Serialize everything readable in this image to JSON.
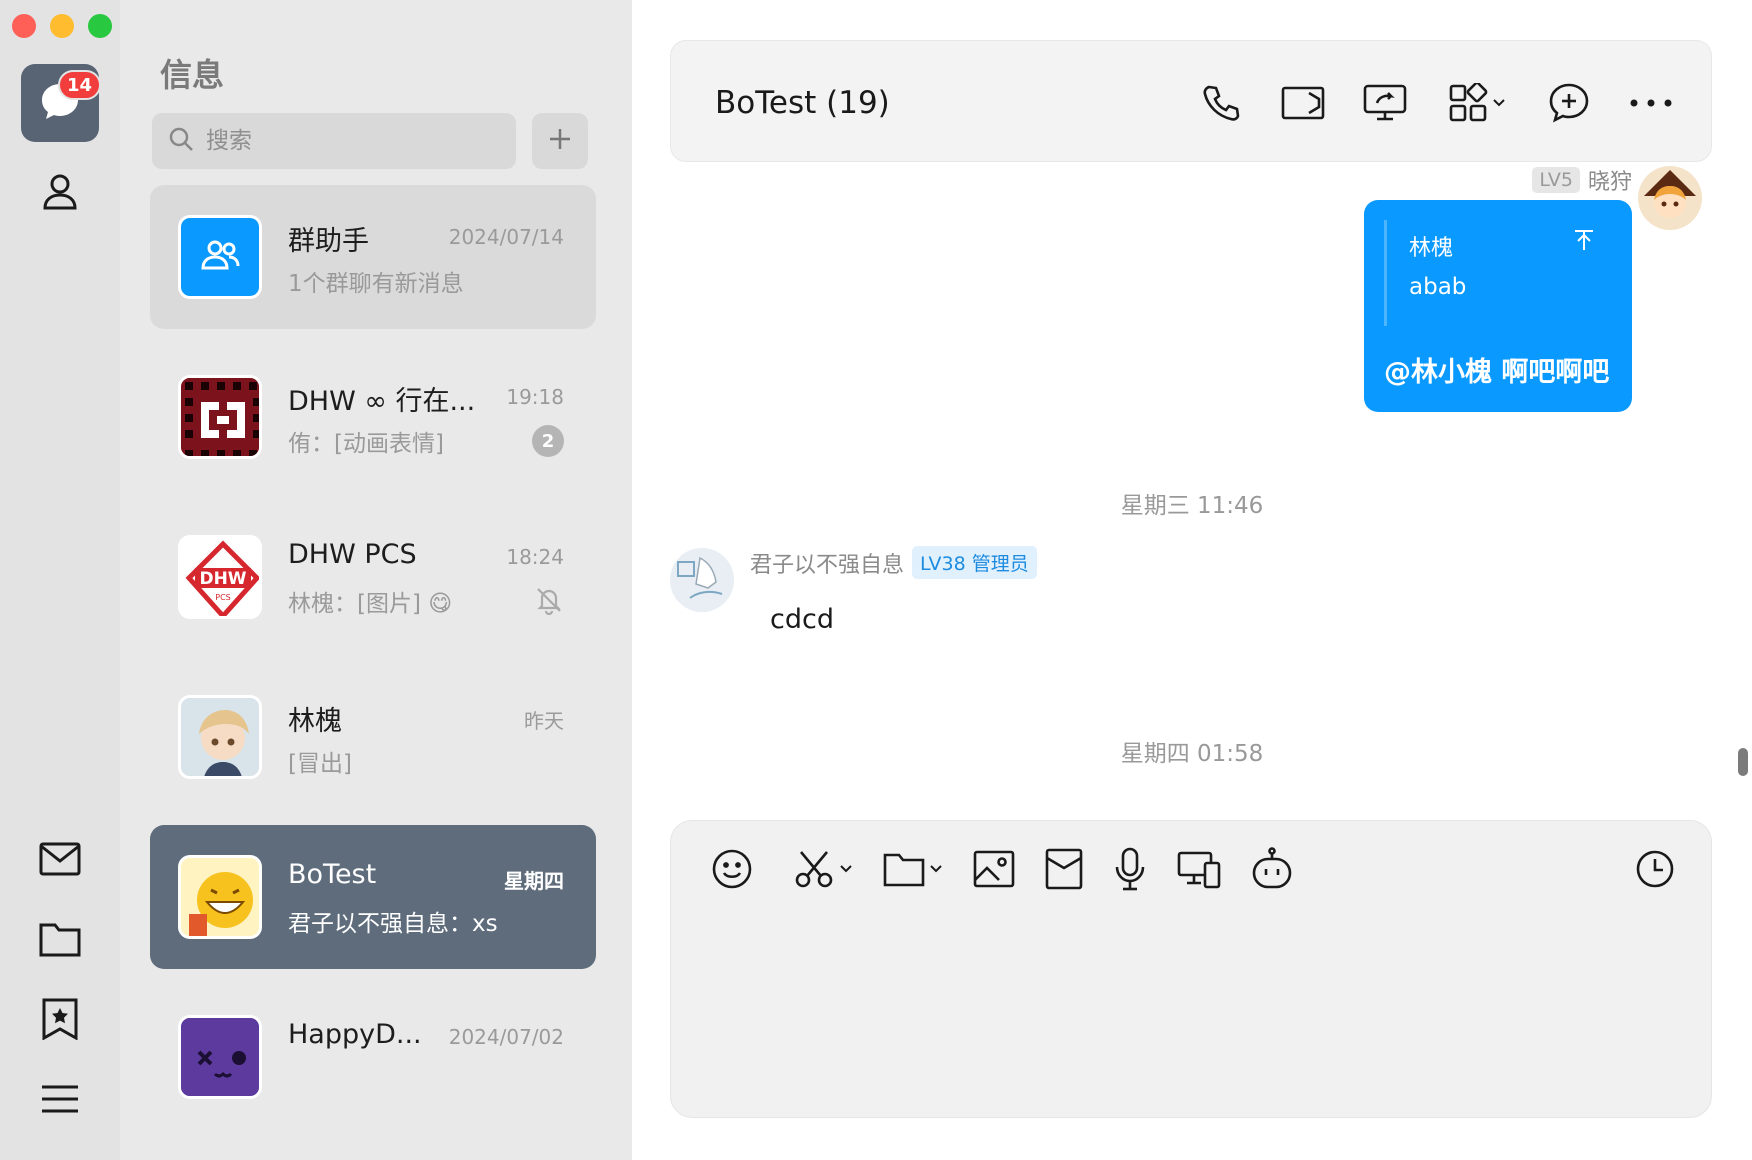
{
  "sidebar": {
    "messages_badge": "14"
  },
  "list": {
    "title": "信息",
    "search_placeholder": "搜索",
    "conversations": [
      {
        "name": "群助手",
        "time": "2024/07/14",
        "preview": "1个群聊有新消息"
      },
      {
        "name": "DHW ∞ 行在...",
        "time": "19:18",
        "preview": "侑：[动画表情]",
        "unread": "2"
      },
      {
        "name": "DHW PCS",
        "time": "18:24",
        "preview": "林槐：[图片] 😋",
        "muted": true
      },
      {
        "name": "林槐",
        "time": "昨天",
        "preview": "[冒出]"
      },
      {
        "name": "BoTest",
        "time": "星期四",
        "preview": "君子以不强自息：xs",
        "selected": true
      },
      {
        "name": "HappyD...",
        "time": "2024/07/02",
        "preview": ""
      }
    ]
  },
  "chat": {
    "title": "BoTest (19)",
    "messages": [
      {
        "direction": "out",
        "sender_level": "LV5",
        "sender_name": "晓狩",
        "quote_name": "林槐",
        "quote_text": "abab",
        "text": "@林小槐 啊吧啊吧"
      },
      {
        "type": "timestamp",
        "text": "星期三 11:46"
      },
      {
        "direction": "in",
        "sender_name": "君子以不强自息",
        "sender_badge": "LV38 管理员",
        "text": "cdcd"
      },
      {
        "type": "timestamp",
        "text": "星期四 01:58"
      }
    ]
  },
  "colors": {
    "accent": "#0a99ff",
    "selected_row": "#5e6c7c",
    "badge_red": "#f23d3d"
  }
}
